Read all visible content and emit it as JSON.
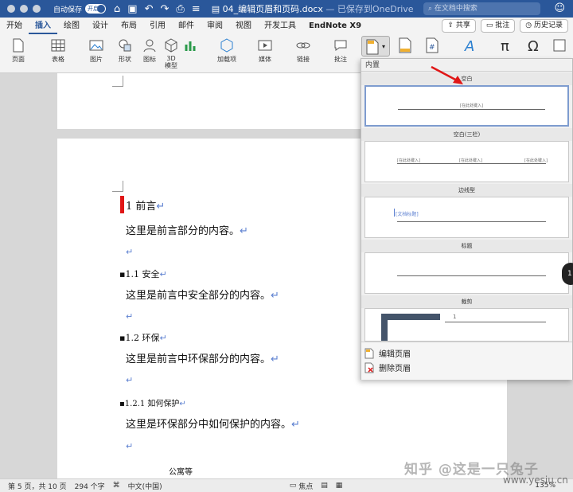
{
  "titlebar": {
    "autosave_label": "自动保存",
    "autosave_state": "开启",
    "document_title": "04_编辑页眉和页码.docx",
    "save_status": " — 已保存到OneDrive",
    "search_placeholder": "在文档中搜索"
  },
  "tabs": [
    "开始",
    "插入",
    "绘图",
    "设计",
    "布局",
    "引用",
    "邮件",
    "审阅",
    "视图",
    "开发工具",
    "EndNote X9"
  ],
  "active_tab": "插入",
  "tab_actions": {
    "share": "共享",
    "comments": "批注",
    "history": "历史记录"
  },
  "ribbon": {
    "page": "页面",
    "table": "表格",
    "picture": "图片",
    "shapes": "形状",
    "icons": "图标",
    "model3d": "3D 模型",
    "addins": "加载项",
    "media": "媒体",
    "link": "链接",
    "comment": "批注"
  },
  "document": {
    "lines": [
      {
        "marker": "",
        "text": "1 前言",
        "style": "h1"
      },
      {
        "marker": "",
        "text": "这里是前言部分的内容。",
        "style": "body"
      },
      {
        "marker": "",
        "text": "",
        "style": "empty"
      },
      {
        "marker": "▪",
        "text": "1.1 安全",
        "style": "h2"
      },
      {
        "marker": "",
        "text": "这里是前言中安全部分的内容。",
        "style": "body"
      },
      {
        "marker": "",
        "text": "",
        "style": "empty"
      },
      {
        "marker": "▪",
        "text": "1.2 环保",
        "style": "h2"
      },
      {
        "marker": "",
        "text": "这里是前言中环保部分的内容。",
        "style": "body"
      },
      {
        "marker": "",
        "text": "",
        "style": "empty"
      },
      {
        "marker": "▪",
        "text": "1.2.1 如何保护",
        "style": "h3"
      },
      {
        "marker": "",
        "text": "这里是环保部分中如何保护的内容。",
        "style": "body"
      },
      {
        "marker": "",
        "text": "",
        "style": "empty"
      }
    ],
    "paragraph_mark": "↵",
    "partial_bottom_text": "公寓等"
  },
  "dropdown": {
    "section_title": "内置",
    "galleries": [
      {
        "name": "空白",
        "placeholders": [
          "[在此处键入]"
        ]
      },
      {
        "name": "空白(三栏)",
        "placeholders": [
          "[在此处键入]",
          "[在此处键入]",
          "[在此处键入]"
        ]
      },
      {
        "name": "边线型",
        "placeholders": [
          "[文档标题]"
        ]
      },
      {
        "name": "标题",
        "placeholders": []
      },
      {
        "name": "裁剪",
        "placeholders": [
          "1"
        ]
      }
    ],
    "actions": {
      "edit_header": "编辑页眉",
      "remove_header": "删除页眉"
    }
  },
  "statusbar": {
    "page_info": "第 5 页，共 10 页",
    "word_count": "294 个字",
    "language": "中文(中国)",
    "focus": "焦点",
    "zoom": "135%"
  },
  "watermark": {
    "zhihu": "知乎 @这是一只兔子",
    "site": "www.yesiu.cn"
  },
  "side_badge": "1",
  "colors": {
    "word_blue": "#2a579a",
    "heading_red_bar": "#e01616",
    "arrow_red": "#e01616"
  }
}
